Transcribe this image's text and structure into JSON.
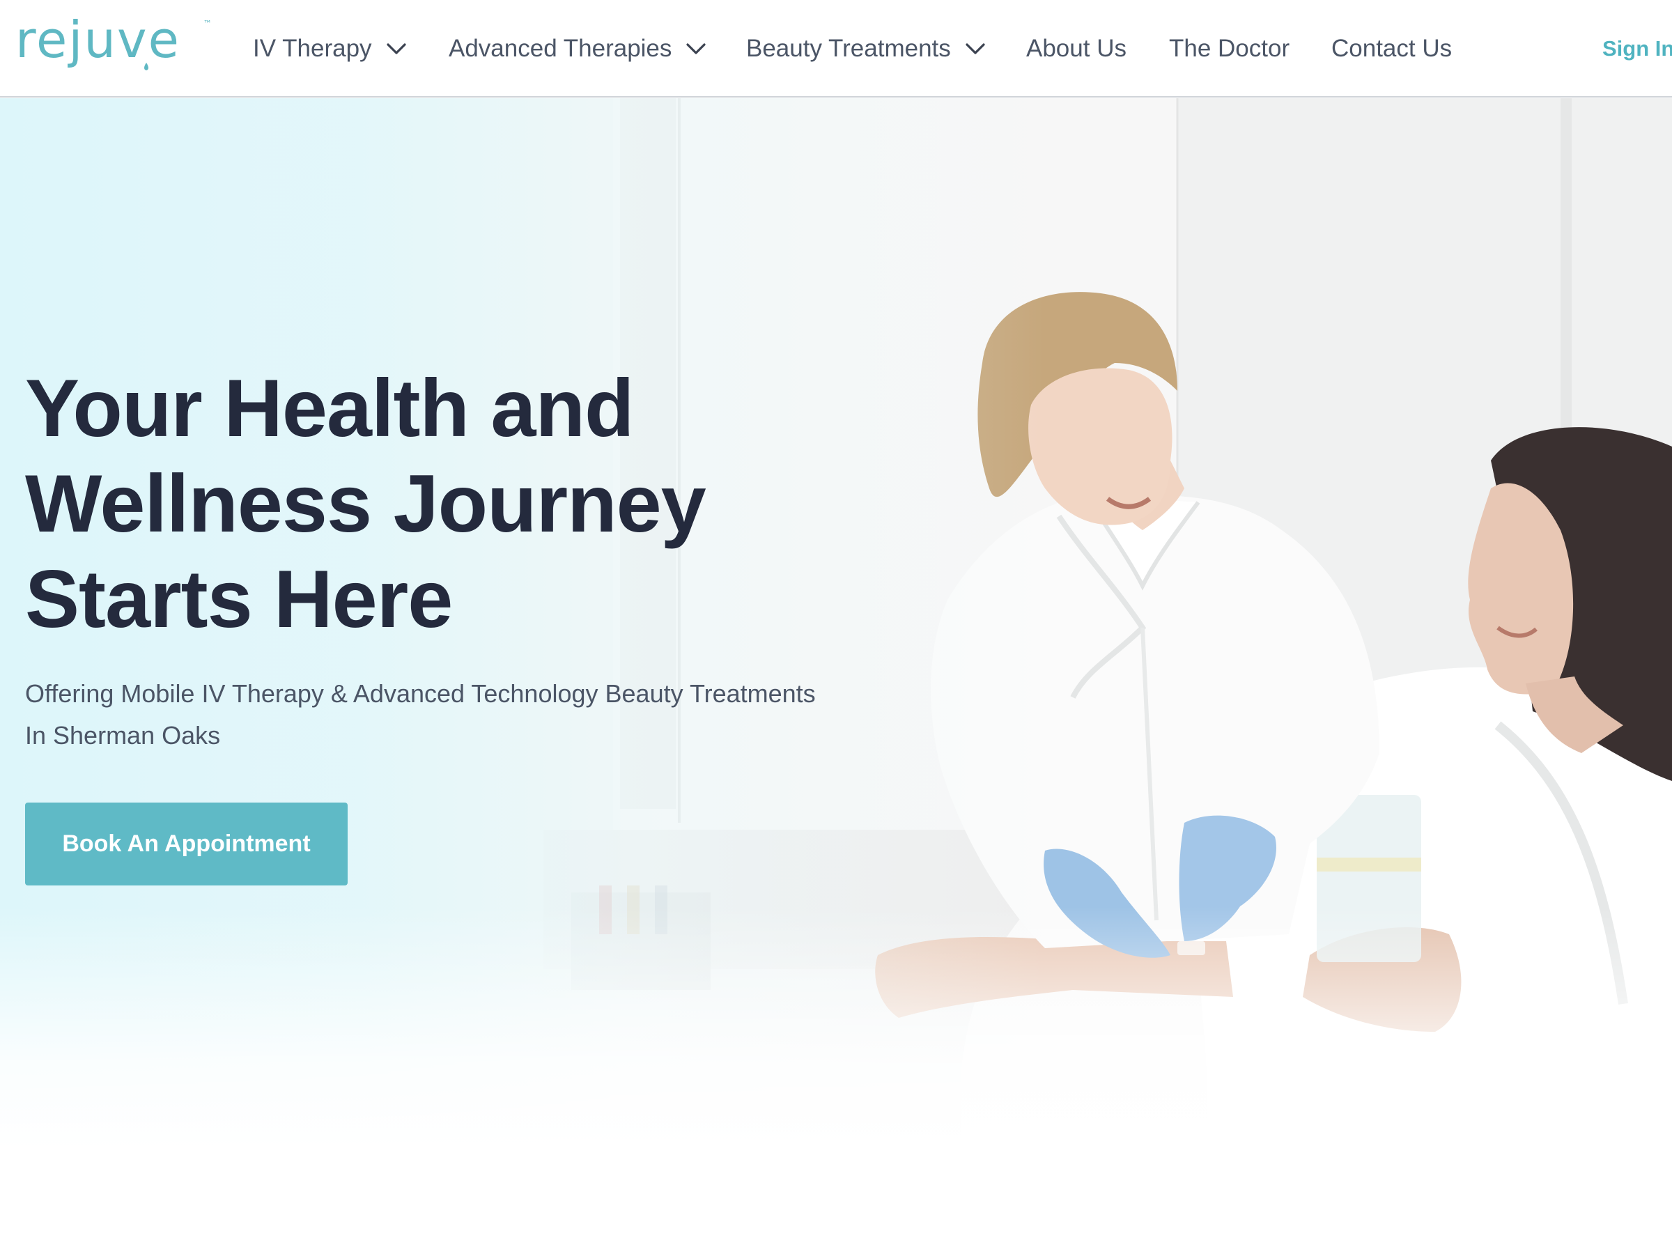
{
  "brand": {
    "logo_text": "rejuve",
    "trademark": "™",
    "accent_color": "#5fb8c3"
  },
  "nav": {
    "items": [
      {
        "label": "IV Therapy",
        "has_dropdown": true,
        "icon": "chevron-down-icon"
      },
      {
        "label": "Advanced Therapies",
        "has_dropdown": true,
        "icon": "chevron-down-icon"
      },
      {
        "label": "Beauty Treatments",
        "has_dropdown": true,
        "icon": "chevron-down-icon"
      },
      {
        "label": "About Us",
        "has_dropdown": false
      },
      {
        "label": "The Doctor",
        "has_dropdown": false
      },
      {
        "label": "Contact Us",
        "has_dropdown": false
      }
    ],
    "signin_label": "Sign In"
  },
  "hero": {
    "headline_lines": [
      "Your Health and",
      "Wellness Journey",
      "Starts Here"
    ],
    "subtext_line1": "Offering Mobile IV Therapy & Advanced Technology Beauty Treatments",
    "subtext_line2": "In Sherman Oaks",
    "cta_label": "Book An Appointment",
    "cta_color": "#5fbac6",
    "headline_color": "#242a3d",
    "image_subject": "clinician-with-patient-photo"
  }
}
